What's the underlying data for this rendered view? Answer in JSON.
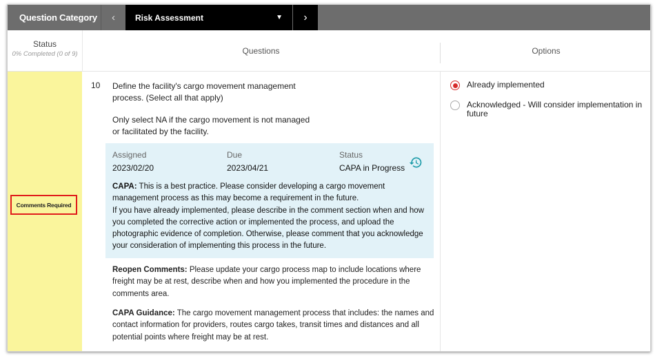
{
  "topbar": {
    "category_label": "Question Category",
    "prev_icon": "chevron-left-icon",
    "selected_category": "Risk Assessment",
    "dropdown_icon": "caret-down-icon",
    "next_icon": "chevron-right-icon"
  },
  "header": {
    "status_title": "Status",
    "status_progress": "0% Completed (0 of 9)",
    "questions_title": "Questions",
    "options_title": "Options"
  },
  "status_badge": "Comments Required",
  "question": {
    "number": "10",
    "text": "Define the facility's cargo movement management process. (Select all that apply)",
    "note": "Only select NA if the cargo movement is not managed or facilitated by the facility."
  },
  "capa": {
    "assigned_label": "Assigned",
    "assigned_value": "2023/02/20",
    "due_label": "Due",
    "due_value": "2023/04/21",
    "status_label": "Status",
    "status_value": "CAPA in Progress",
    "history_icon": "history-icon",
    "capa_prefix": "CAPA:",
    "capa_text": " This is a best practice. Please consider developing a cargo movement management process as this may become a requirement in the future.",
    "capa_text2": "If you have already implemented, please describe in the comment section when and how you completed the corrective action or implemented the process, and upload the photographic evidence of completion. Otherwise, please comment that you acknowledge your consideration of implementing this process in the future."
  },
  "reopen": {
    "prefix": "Reopen Comments:",
    "text": " Please update your cargo process map to include locations where freight may be at rest, describe when and how you implemented the procedure in the comments area."
  },
  "guidance": {
    "prefix": "CAPA Guidance:",
    "text": " The cargo movement management process that includes: the names and contact information for providers, routes cargo takes, transit times and distances and all potential points where freight may be at rest."
  },
  "options": [
    {
      "label": "Already implemented",
      "selected": true
    },
    {
      "label": "Acknowledged - Will consider implementation in future",
      "selected": false
    }
  ],
  "colors": {
    "status_bg": "#faf59c",
    "badge_border": "#e01b1b",
    "capa_bg": "#e2f2f8",
    "radio_selected": "#d62a2a",
    "history_icon": "#1a9aa8"
  }
}
